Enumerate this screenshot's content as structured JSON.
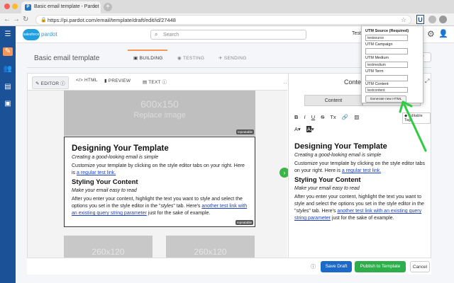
{
  "browser": {
    "tab_title": "Basic email template - Pardot",
    "tab_icon": "P",
    "url": "https://pi.pardot.com/email/template/draft/edit/id/27448",
    "extension_icon": "U"
  },
  "header": {
    "logo_text": "salesforce",
    "logo_sub": "pardot",
    "search_placeholder": "Search",
    "user_name": "Testi"
  },
  "page": {
    "title": "Basic email template",
    "steps": [
      {
        "label": "BUILDING"
      },
      {
        "label": "TESTING"
      },
      {
        "label": "SENDING"
      }
    ]
  },
  "editor_tabs": [
    {
      "label": "EDITOR"
    },
    {
      "label": "HTML"
    },
    {
      "label": "PREVIEW"
    },
    {
      "label": "TEXT"
    }
  ],
  "canvas": {
    "hero_size": "600x150",
    "hero_text": "Replace image",
    "repeatable": "repeatable",
    "col1": "260x120",
    "col2": "260x120"
  },
  "email": {
    "h1": "Designing Your Template",
    "em1": "Creating a good-looking email is simple",
    "p1_pre": "Customize your template by clicking on the style editor tabs on your right. Here is ",
    "p1_link": "a regular test link.",
    "h2": "Styling Your Content",
    "em2": "Make your email easy to read",
    "p2_pre": "After you enter your content, highlight the text you want to style and select the options you set in the style editor in the \"",
    "p2_em": "styles",
    "p2_mid": "\" tab. Here's ",
    "p2_link": "another test link with an existing query string parameter",
    "p2_post": " just for the sake of example."
  },
  "right_panel": {
    "title": "Content",
    "tab": "Content",
    "editable_tag": "Editable Tag"
  },
  "utm_popup": {
    "source_label": "UTM Source (Required)",
    "source_value": "testsource",
    "campaign_label": "UTM Campaign",
    "campaign_value": "",
    "medium_label": "UTM Medium",
    "medium_value": "testmedium",
    "term_label": "UTM Term",
    "term_value": "",
    "content_label": "UTM Content",
    "content_value": "testcontent",
    "generate_label": "Generate new HTML"
  },
  "footer": {
    "save_draft": "Save Draft",
    "publish": "Publish to Template",
    "cancel": "Cancel"
  },
  "colors": {
    "nav_blue": "#1b5297",
    "accent_orange": "#f49756",
    "primary_blue": "#1b6ac9",
    "publish_green": "#2dae4a",
    "annotation_green": "#2ecc40"
  }
}
